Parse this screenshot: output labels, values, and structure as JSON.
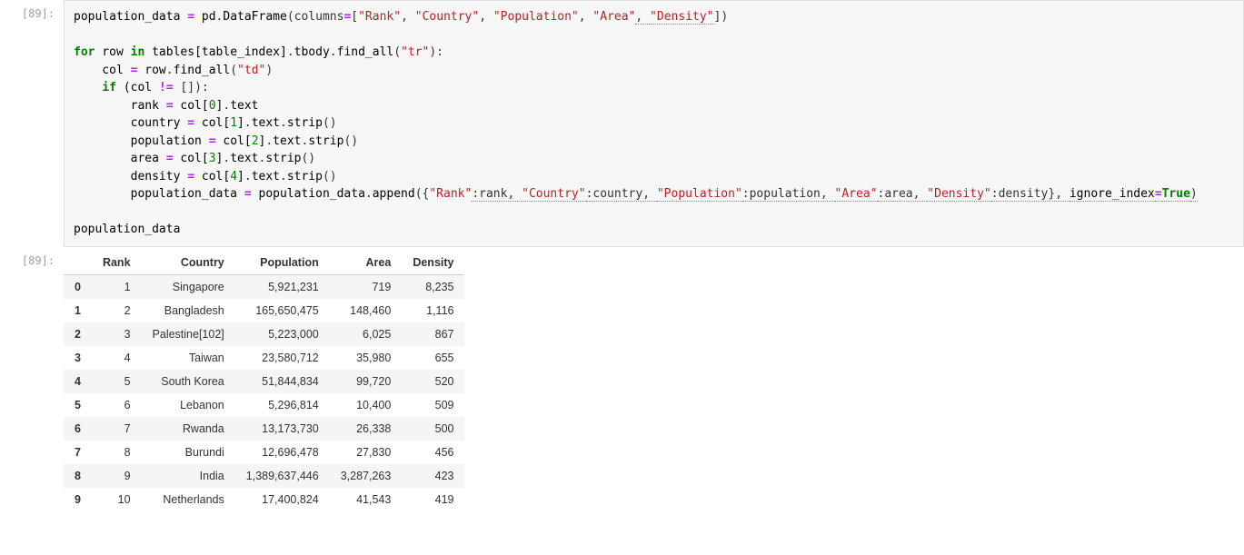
{
  "input": {
    "prompt": "[89]:",
    "lines": [
      {
        "segments": [
          {
            "t": "population_data ",
            "c": "tk-name"
          },
          {
            "t": "= ",
            "c": "tk-op"
          },
          {
            "t": "pd",
            "c": "tk-name"
          },
          {
            "t": ".",
            "c": "tk-punc"
          },
          {
            "t": "DataFrame",
            "c": "tk-name"
          },
          {
            "t": "(columns",
            "c": "tk-punc"
          },
          {
            "t": "=",
            "c": "tk-op"
          },
          {
            "t": "[",
            "c": "tk-punc"
          },
          {
            "t": "\"Rank\"",
            "c": "tk-str"
          },
          {
            "t": ", ",
            "c": "tk-punc"
          },
          {
            "t": "\"Country\"",
            "c": "tk-str"
          },
          {
            "t": ", ",
            "c": "tk-punc"
          },
          {
            "t": "\"Population\"",
            "c": "tk-str"
          },
          {
            "t": ", ",
            "c": "tk-punc"
          },
          {
            "t": "\"Area\"",
            "c": "tk-str"
          },
          {
            "t": ", ",
            "c": "tk-punc tk-dotted"
          },
          {
            "t": "\"Density\"",
            "c": "tk-str tk-dotted"
          },
          {
            "t": "])",
            "c": "tk-punc"
          }
        ]
      },
      {
        "segments": [
          {
            "t": "",
            "c": ""
          }
        ]
      },
      {
        "segments": [
          {
            "t": "for",
            "c": "tk-kw"
          },
          {
            "t": " row ",
            "c": "tk-name"
          },
          {
            "t": "in",
            "c": "tk-kw"
          },
          {
            "t": " tables[table_index]",
            "c": "tk-name"
          },
          {
            "t": ".",
            "c": "tk-punc"
          },
          {
            "t": "tbody",
            "c": "tk-name"
          },
          {
            "t": ".",
            "c": "tk-punc"
          },
          {
            "t": "find_all",
            "c": "tk-name"
          },
          {
            "t": "(",
            "c": "tk-punc"
          },
          {
            "t": "\"tr\"",
            "c": "tk-str"
          },
          {
            "t": "):",
            "c": "tk-punc"
          }
        ]
      },
      {
        "segments": [
          {
            "t": "    col ",
            "c": "tk-name"
          },
          {
            "t": "= ",
            "c": "tk-op"
          },
          {
            "t": "row",
            "c": "tk-name"
          },
          {
            "t": ".",
            "c": "tk-punc"
          },
          {
            "t": "find_all",
            "c": "tk-name"
          },
          {
            "t": "(",
            "c": "tk-punc"
          },
          {
            "t": "\"td\"",
            "c": "tk-str"
          },
          {
            "t": ")",
            "c": "tk-punc"
          }
        ]
      },
      {
        "segments": [
          {
            "t": "    ",
            "c": ""
          },
          {
            "t": "if",
            "c": "tk-kw"
          },
          {
            "t": " (col ",
            "c": "tk-name"
          },
          {
            "t": "!= ",
            "c": "tk-op"
          },
          {
            "t": "[]):",
            "c": "tk-punc"
          }
        ]
      },
      {
        "segments": [
          {
            "t": "        rank ",
            "c": "tk-name"
          },
          {
            "t": "= ",
            "c": "tk-op"
          },
          {
            "t": "col[",
            "c": "tk-name"
          },
          {
            "t": "0",
            "c": "tk-builtin"
          },
          {
            "t": "]",
            "c": "tk-name"
          },
          {
            "t": ".",
            "c": "tk-punc"
          },
          {
            "t": "text",
            "c": "tk-name"
          }
        ]
      },
      {
        "segments": [
          {
            "t": "        country ",
            "c": "tk-name"
          },
          {
            "t": "= ",
            "c": "tk-op"
          },
          {
            "t": "col[",
            "c": "tk-name"
          },
          {
            "t": "1",
            "c": "tk-builtin"
          },
          {
            "t": "]",
            "c": "tk-name"
          },
          {
            "t": ".",
            "c": "tk-punc"
          },
          {
            "t": "text",
            "c": "tk-name"
          },
          {
            "t": ".",
            "c": "tk-punc"
          },
          {
            "t": "strip",
            "c": "tk-name"
          },
          {
            "t": "()",
            "c": "tk-punc"
          }
        ]
      },
      {
        "segments": [
          {
            "t": "        population ",
            "c": "tk-name"
          },
          {
            "t": "= ",
            "c": "tk-op"
          },
          {
            "t": "col[",
            "c": "tk-name"
          },
          {
            "t": "2",
            "c": "tk-builtin"
          },
          {
            "t": "]",
            "c": "tk-name"
          },
          {
            "t": ".",
            "c": "tk-punc"
          },
          {
            "t": "text",
            "c": "tk-name"
          },
          {
            "t": ".",
            "c": "tk-punc"
          },
          {
            "t": "strip",
            "c": "tk-name"
          },
          {
            "t": "()",
            "c": "tk-punc"
          }
        ]
      },
      {
        "segments": [
          {
            "t": "        area ",
            "c": "tk-name"
          },
          {
            "t": "= ",
            "c": "tk-op"
          },
          {
            "t": "col[",
            "c": "tk-name"
          },
          {
            "t": "3",
            "c": "tk-builtin"
          },
          {
            "t": "]",
            "c": "tk-name"
          },
          {
            "t": ".",
            "c": "tk-punc"
          },
          {
            "t": "text",
            "c": "tk-name"
          },
          {
            "t": ".",
            "c": "tk-punc"
          },
          {
            "t": "strip",
            "c": "tk-name"
          },
          {
            "t": "()",
            "c": "tk-punc"
          }
        ]
      },
      {
        "segments": [
          {
            "t": "        density ",
            "c": "tk-name"
          },
          {
            "t": "= ",
            "c": "tk-op"
          },
          {
            "t": "col[",
            "c": "tk-name"
          },
          {
            "t": "4",
            "c": "tk-builtin"
          },
          {
            "t": "]",
            "c": "tk-name"
          },
          {
            "t": ".",
            "c": "tk-punc"
          },
          {
            "t": "text",
            "c": "tk-name"
          },
          {
            "t": ".",
            "c": "tk-punc"
          },
          {
            "t": "strip",
            "c": "tk-name"
          },
          {
            "t": "()",
            "c": "tk-punc"
          }
        ]
      },
      {
        "segments": [
          {
            "t": "        population_data ",
            "c": "tk-name"
          },
          {
            "t": "= ",
            "c": "tk-op"
          },
          {
            "t": "population_data",
            "c": "tk-name"
          },
          {
            "t": ".",
            "c": "tk-punc"
          },
          {
            "t": "append",
            "c": "tk-name"
          },
          {
            "t": "({",
            "c": "tk-punc"
          },
          {
            "t": "\"Rank\"",
            "c": "tk-str"
          },
          {
            "t": ":rank, ",
            "c": "tk-punc tk-dotted"
          },
          {
            "t": "\"Country\"",
            "c": "tk-str tk-dotted"
          },
          {
            "t": ":country, ",
            "c": "tk-punc tk-dotted"
          },
          {
            "t": "\"Population\"",
            "c": "tk-str tk-dotted"
          },
          {
            "t": ":population, ",
            "c": "tk-punc tk-dotted"
          },
          {
            "t": "\"Area\"",
            "c": "tk-str tk-dotted"
          },
          {
            "t": ":area, ",
            "c": "tk-punc tk-dotted"
          },
          {
            "t": "\"Density\"",
            "c": "tk-str tk-dotted"
          },
          {
            "t": ":density}, ",
            "c": "tk-punc tk-dotted"
          },
          {
            "t": "ignore_index",
            "c": "tk-name tk-dotted"
          },
          {
            "t": "=",
            "c": "tk-op tk-dotted"
          },
          {
            "t": "True",
            "c": "tk-kw tk-dotted"
          },
          {
            "t": ")",
            "c": "tk-punc tk-dotted"
          }
        ]
      },
      {
        "segments": [
          {
            "t": "",
            "c": ""
          }
        ]
      },
      {
        "segments": [
          {
            "t": "population_data",
            "c": "tk-name"
          }
        ]
      }
    ]
  },
  "output": {
    "prompt": "[89]:",
    "columns": [
      "Rank",
      "Country",
      "Population",
      "Area",
      "Density"
    ],
    "rows": [
      {
        "idx": "0",
        "Rank": "1",
        "Country": "Singapore",
        "Population": "5,921,231",
        "Area": "719",
        "Density": "8,235"
      },
      {
        "idx": "1",
        "Rank": "2",
        "Country": "Bangladesh",
        "Population": "165,650,475",
        "Area": "148,460",
        "Density": "1,116"
      },
      {
        "idx": "2",
        "Rank": "3",
        "Country": "Palestine[102]",
        "Population": "5,223,000",
        "Area": "6,025",
        "Density": "867"
      },
      {
        "idx": "3",
        "Rank": "4",
        "Country": "Taiwan",
        "Population": "23,580,712",
        "Area": "35,980",
        "Density": "655"
      },
      {
        "idx": "4",
        "Rank": "5",
        "Country": "South Korea",
        "Population": "51,844,834",
        "Area": "99,720",
        "Density": "520"
      },
      {
        "idx": "5",
        "Rank": "6",
        "Country": "Lebanon",
        "Population": "5,296,814",
        "Area": "10,400",
        "Density": "509"
      },
      {
        "idx": "6",
        "Rank": "7",
        "Country": "Rwanda",
        "Population": "13,173,730",
        "Area": "26,338",
        "Density": "500"
      },
      {
        "idx": "7",
        "Rank": "8",
        "Country": "Burundi",
        "Population": "12,696,478",
        "Area": "27,830",
        "Density": "456"
      },
      {
        "idx": "8",
        "Rank": "9",
        "Country": "India",
        "Population": "1,389,637,446",
        "Area": "3,287,263",
        "Density": "423"
      },
      {
        "idx": "9",
        "Rank": "10",
        "Country": "Netherlands",
        "Population": "17,400,824",
        "Area": "41,543",
        "Density": "419"
      }
    ]
  }
}
